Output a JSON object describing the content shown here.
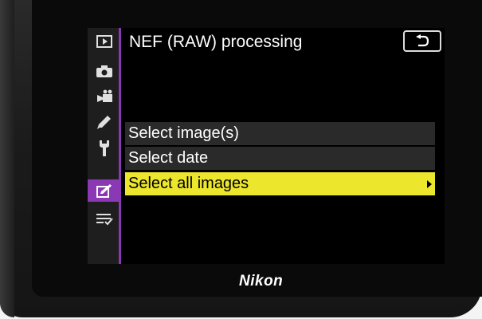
{
  "menu": {
    "title": "NEF (RAW) processing",
    "items": [
      {
        "label": "Select image(s)",
        "selected": false
      },
      {
        "label": "Select date",
        "selected": false
      },
      {
        "label": "Select all images",
        "selected": true
      }
    ]
  },
  "sidebar": {
    "tabs": [
      {
        "icon": "playback-icon",
        "active": false
      },
      {
        "icon": "photo-shooting-icon",
        "active": false
      },
      {
        "icon": "movie-shooting-icon",
        "active": false
      },
      {
        "icon": "custom-settings-pencil-icon",
        "active": false
      },
      {
        "icon": "setup-wrench-icon",
        "active": false
      },
      {
        "icon": "retouch-icon",
        "active": true
      },
      {
        "icon": "my-menu-icon",
        "active": false
      }
    ]
  },
  "camera": {
    "brand": "Nikon"
  },
  "colors": {
    "accent_purple": "#8b38b5",
    "highlight_yellow": "#ece62c"
  }
}
